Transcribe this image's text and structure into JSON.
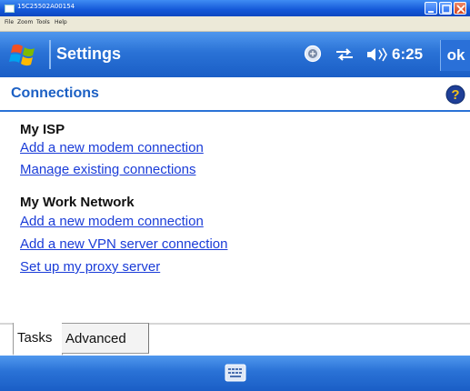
{
  "window": {
    "title": "15C25502A00154",
    "menu": [
      "File",
      "Zoom",
      "Tools",
      "Help"
    ]
  },
  "device": {
    "title": "Settings",
    "clock": "6:25",
    "ok_label": "ok",
    "status_icons": [
      "connectivity-icon",
      "data-sync-icon",
      "volume-icon"
    ]
  },
  "page": {
    "title": "Connections",
    "help_icon": "help-icon"
  },
  "sections": [
    {
      "heading": "My ISP",
      "links": [
        "Add a new modem connection",
        "Manage existing connections"
      ]
    },
    {
      "heading": "My Work Network",
      "links": [
        "Add a new modem connection",
        "Add a new VPN server connection",
        "Set up my proxy server"
      ]
    }
  ],
  "tabs": [
    {
      "label": "Tasks",
      "selected": true
    },
    {
      "label": "Advanced",
      "selected": false
    }
  ],
  "bottom_bar": {
    "icon": "keyboard-icon"
  },
  "colors": {
    "accent": "#2a72d6",
    "link": "#1a3cd8",
    "title": "#1c60c4"
  }
}
